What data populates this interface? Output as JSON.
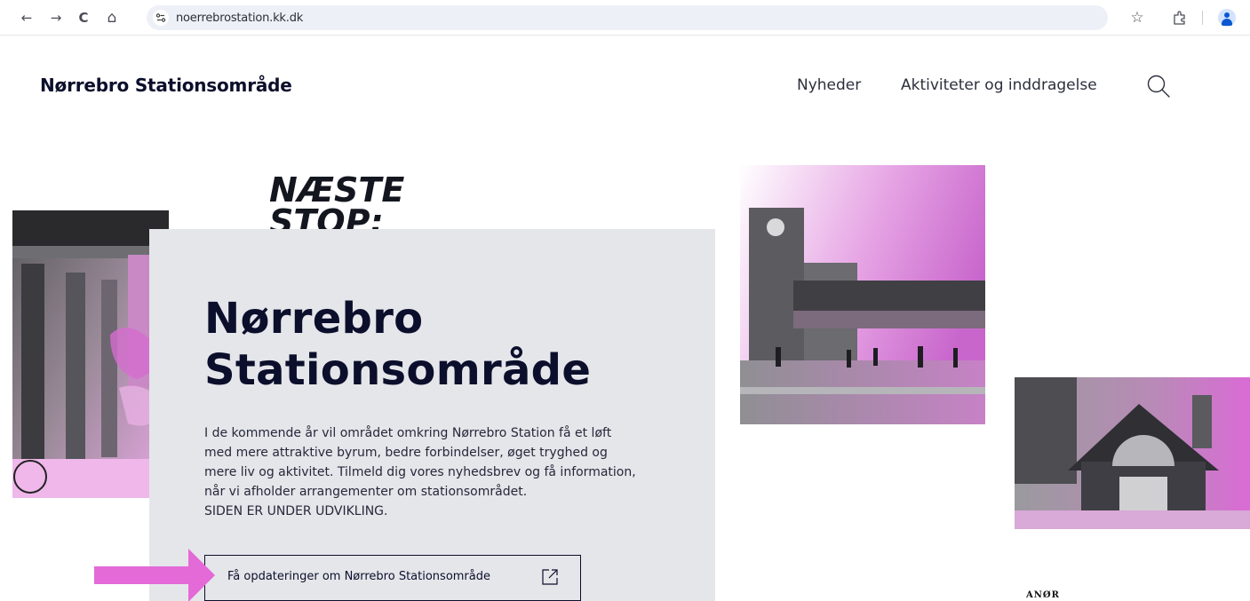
{
  "browser": {
    "url": "noerrebrostation.kk.dk",
    "back_icon": "←",
    "forward_icon": "→",
    "reload_icon": "C",
    "home_icon": "⌂",
    "star_icon": "☆",
    "extensions_icon": "⍐"
  },
  "header": {
    "brand": "Nørrebro Stationsområde",
    "nav": [
      {
        "label": "Nyheder"
      },
      {
        "label": "Aktiviteter og inddragelse"
      }
    ],
    "search_icon": "search-icon"
  },
  "graphic": {
    "line1": "NÆSTE",
    "line2": "STOP:"
  },
  "hero": {
    "title_line1": "Nørrebro",
    "title_line2": "Stationsområde",
    "text_lines": [
      "I de kommende år vil området omkring Nørrebro Station få et løft",
      "med mere attraktive byrum, bedre forbindelser, øget tryghed og",
      "mere liv og aktivitet. Tilmeld dig vores nyhedsbrev og få information,",
      "når vi afholder arrangementer om stationsområdet.",
      "SIDEN ER UNDER UDVIKLING."
    ],
    "cta_label": "Få opdateringer om Nørrebro Stationsområde",
    "cta_icon": "external-link-icon"
  },
  "stamp": {
    "text": "ANØR"
  },
  "colors": {
    "accent_magenta": "#e063d6",
    "arrow": "#e36ad7",
    "hero_bg": "#e5e6ea",
    "navy": "#0b0f2b"
  }
}
